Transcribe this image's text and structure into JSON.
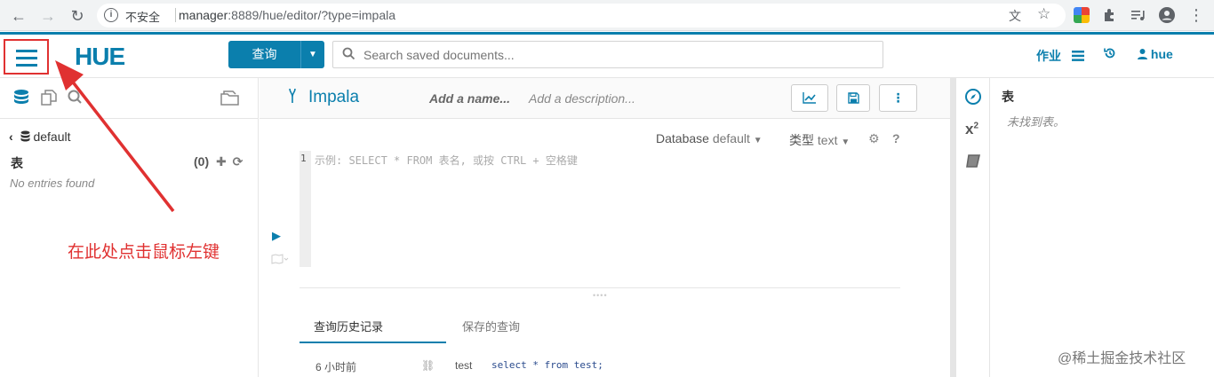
{
  "browser": {
    "back_icon": "←",
    "forward_icon": "→",
    "reload_icon": "↻",
    "insecure_label": "不安全",
    "url_host": "manager",
    "url_rest": ":8889/hue/editor/?type=impala",
    "translate_icon": "文",
    "star_icon": "☆"
  },
  "hue": {
    "logo_text": "HUE",
    "query_button": "查询",
    "search_placeholder": "Search saved documents...",
    "jobs_label": "作业",
    "user_label": "hue"
  },
  "left_panel": {
    "database": "default",
    "tables_heading": "表",
    "table_count": "(0)",
    "no_entries": "No entries found"
  },
  "annotation": "在此处点击鼠标左键",
  "editor": {
    "type": "Impala",
    "name_placeholder": "Add a name...",
    "description_placeholder": "Add a description...",
    "database_label": "Database",
    "database_value": "default",
    "type_label": "类型",
    "type_value": "text",
    "line_number": "1",
    "code_placeholder": "示例: SELECT * FROM 表名, 或按 CTRL + 空格键",
    "tabs": [
      {
        "label": "查询历史记录",
        "active": true
      },
      {
        "label": "保存的查询",
        "active": false
      }
    ],
    "history": [
      {
        "time": "6 小时前",
        "db": "test",
        "query": "select * from test;"
      }
    ]
  },
  "right_panel": {
    "title": "表",
    "empty_text": "未找到表。"
  },
  "watermark": "@稀土掘金技术社区"
}
